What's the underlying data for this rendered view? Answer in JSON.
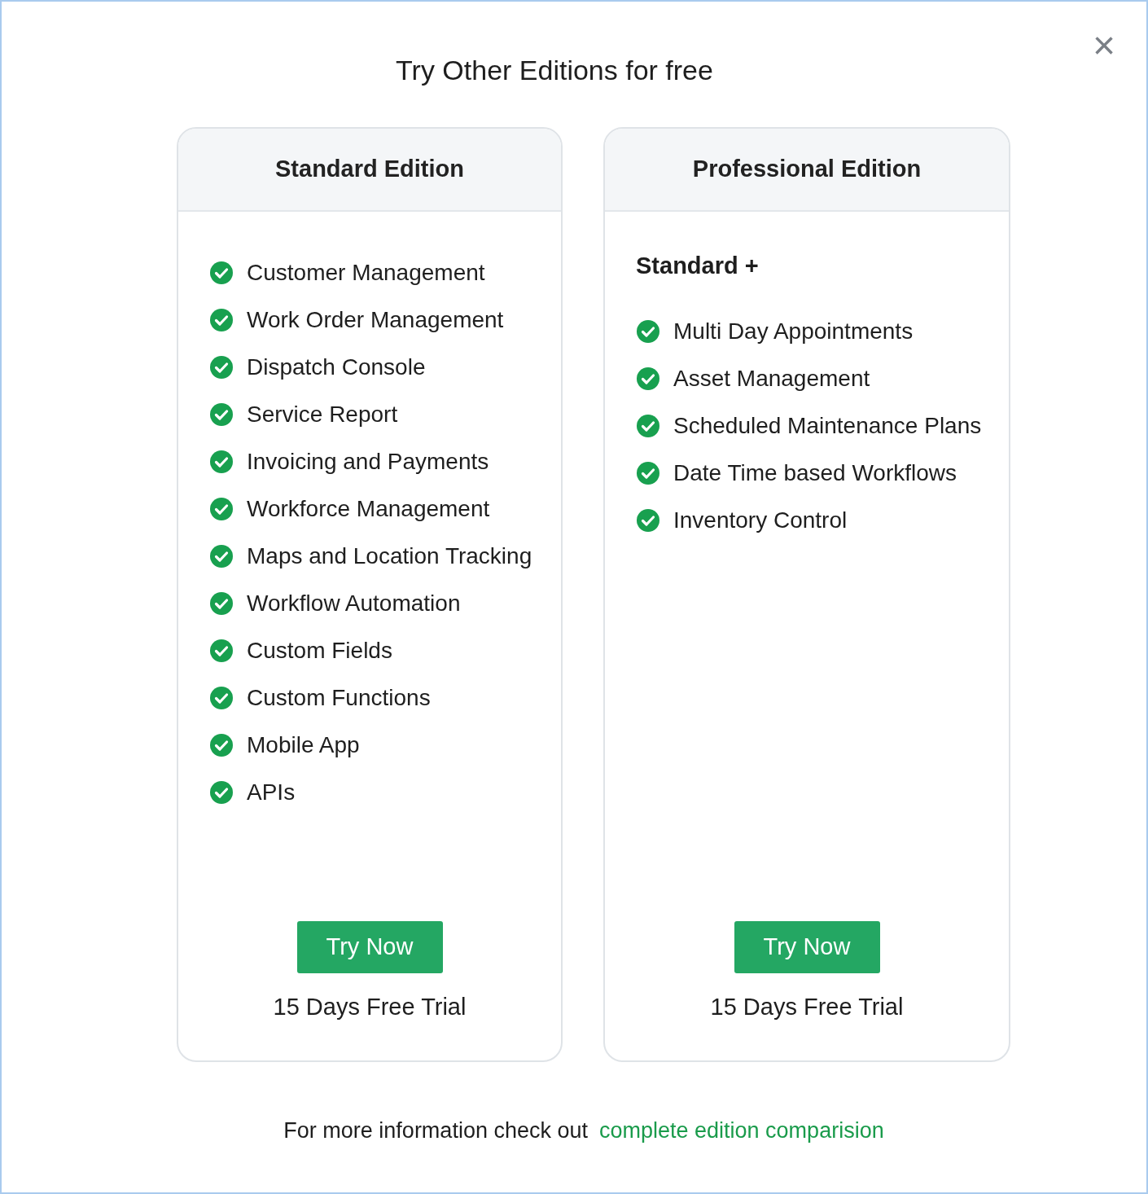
{
  "dialog": {
    "title": "Try Other Editions for free",
    "close": "×"
  },
  "editions": [
    {
      "name": "Standard Edition",
      "features": [
        "Customer Management",
        "Work Order Management",
        "Dispatch Console",
        "Service Report",
        "Invoicing and Payments",
        "Workforce Management",
        "Maps and Location Tracking",
        "Workflow Automation",
        "Custom Fields",
        "Custom Functions",
        "Mobile App",
        "APIs"
      ],
      "button": "Try Now",
      "trial": "15 Days Free Trial"
    },
    {
      "name": "Professional Edition",
      "intro": "Standard +",
      "features": [
        "Multi Day Appointments",
        "Asset Management",
        "Scheduled Maintenance Plans",
        "Date Time based Workflows",
        "Inventory Control"
      ],
      "button": "Try Now",
      "trial": "15 Days Free Trial"
    }
  ],
  "footer": {
    "text": "For more information check out",
    "link": "complete edition comparision"
  }
}
